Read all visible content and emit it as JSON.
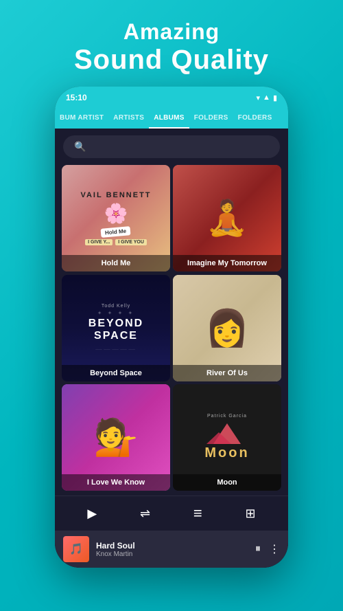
{
  "header": {
    "line1": "Amazing",
    "line2": "Sound Quality"
  },
  "phone": {
    "status_time": "15:10",
    "status_icons": [
      "wifi",
      "signal",
      "battery"
    ]
  },
  "nav": {
    "tabs": [
      {
        "label": "BUM ARTIST",
        "active": false
      },
      {
        "label": "ARTISTS",
        "active": false
      },
      {
        "label": "ALBUMS",
        "active": true
      },
      {
        "label": "FOLDERS",
        "active": false
      },
      {
        "label": "FOLDERS",
        "active": false
      }
    ]
  },
  "search": {
    "placeholder": "Search"
  },
  "albums": [
    {
      "id": "hold-me",
      "title": "Hold Me",
      "artist": "Vail Bennett",
      "type": "illustrated"
    },
    {
      "id": "imagine-my-tomorrow",
      "title": "Imagine My Tomorrow",
      "artist": "",
      "type": "photo"
    },
    {
      "id": "beyond-space",
      "title": "Beyond Space",
      "artist": "Todd Kelly",
      "type": "dark"
    },
    {
      "id": "river-of-us",
      "title": "River Of Us",
      "artist": "",
      "type": "photo"
    },
    {
      "id": "i-love-we-know",
      "title": "I Love We Know",
      "artist": "",
      "type": "photo"
    },
    {
      "id": "moon",
      "title": "Moon",
      "artist": "Patrick Garcia",
      "type": "dark"
    }
  ],
  "controls": {
    "play": "▶",
    "shuffle": "⇌",
    "equalizer": "≡",
    "queue": "⊞"
  },
  "now_playing": {
    "title": "Hard Soul",
    "artist": "Knox Martin",
    "play_icon": "⏸",
    "more_icon": "⋮"
  },
  "colors": {
    "bg_teal": "#1eccd4",
    "app_dark": "#1a1a2e"
  }
}
